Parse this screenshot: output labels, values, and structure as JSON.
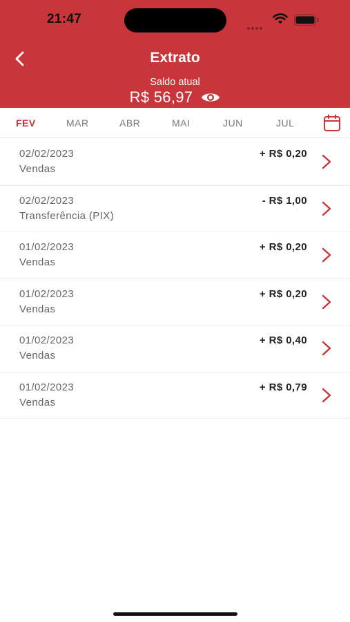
{
  "status_bar": {
    "time": "21:47"
  },
  "header": {
    "title": "Extrato",
    "saldo_label": "Saldo atual",
    "saldo_value": "R$ 56,97",
    "back_icon": "chevron-left-icon",
    "eye_icon": "eye-icon",
    "color": "#c8363b"
  },
  "tabs": {
    "items": [
      "FEV",
      "MAR",
      "ABR",
      "MAI",
      "JUN",
      "JUL"
    ],
    "active": "FEV",
    "calendar_icon": "calendar-icon"
  },
  "transactions": [
    {
      "date": "02/02/2023",
      "description": "Vendas",
      "amount": "+ R$ 0,20"
    },
    {
      "date": "02/02/2023",
      "description": "Transferência (PIX)",
      "amount": "- R$ 1,00"
    },
    {
      "date": "01/02/2023",
      "description": "Vendas",
      "amount": "+ R$ 0,20"
    },
    {
      "date": "01/02/2023",
      "description": "Vendas",
      "amount": "+ R$ 0,20"
    },
    {
      "date": "01/02/2023",
      "description": "Vendas",
      "amount": "+ R$ 0,40"
    },
    {
      "date": "01/02/2023",
      "description": "Vendas",
      "amount": "+ R$ 0,79"
    }
  ]
}
